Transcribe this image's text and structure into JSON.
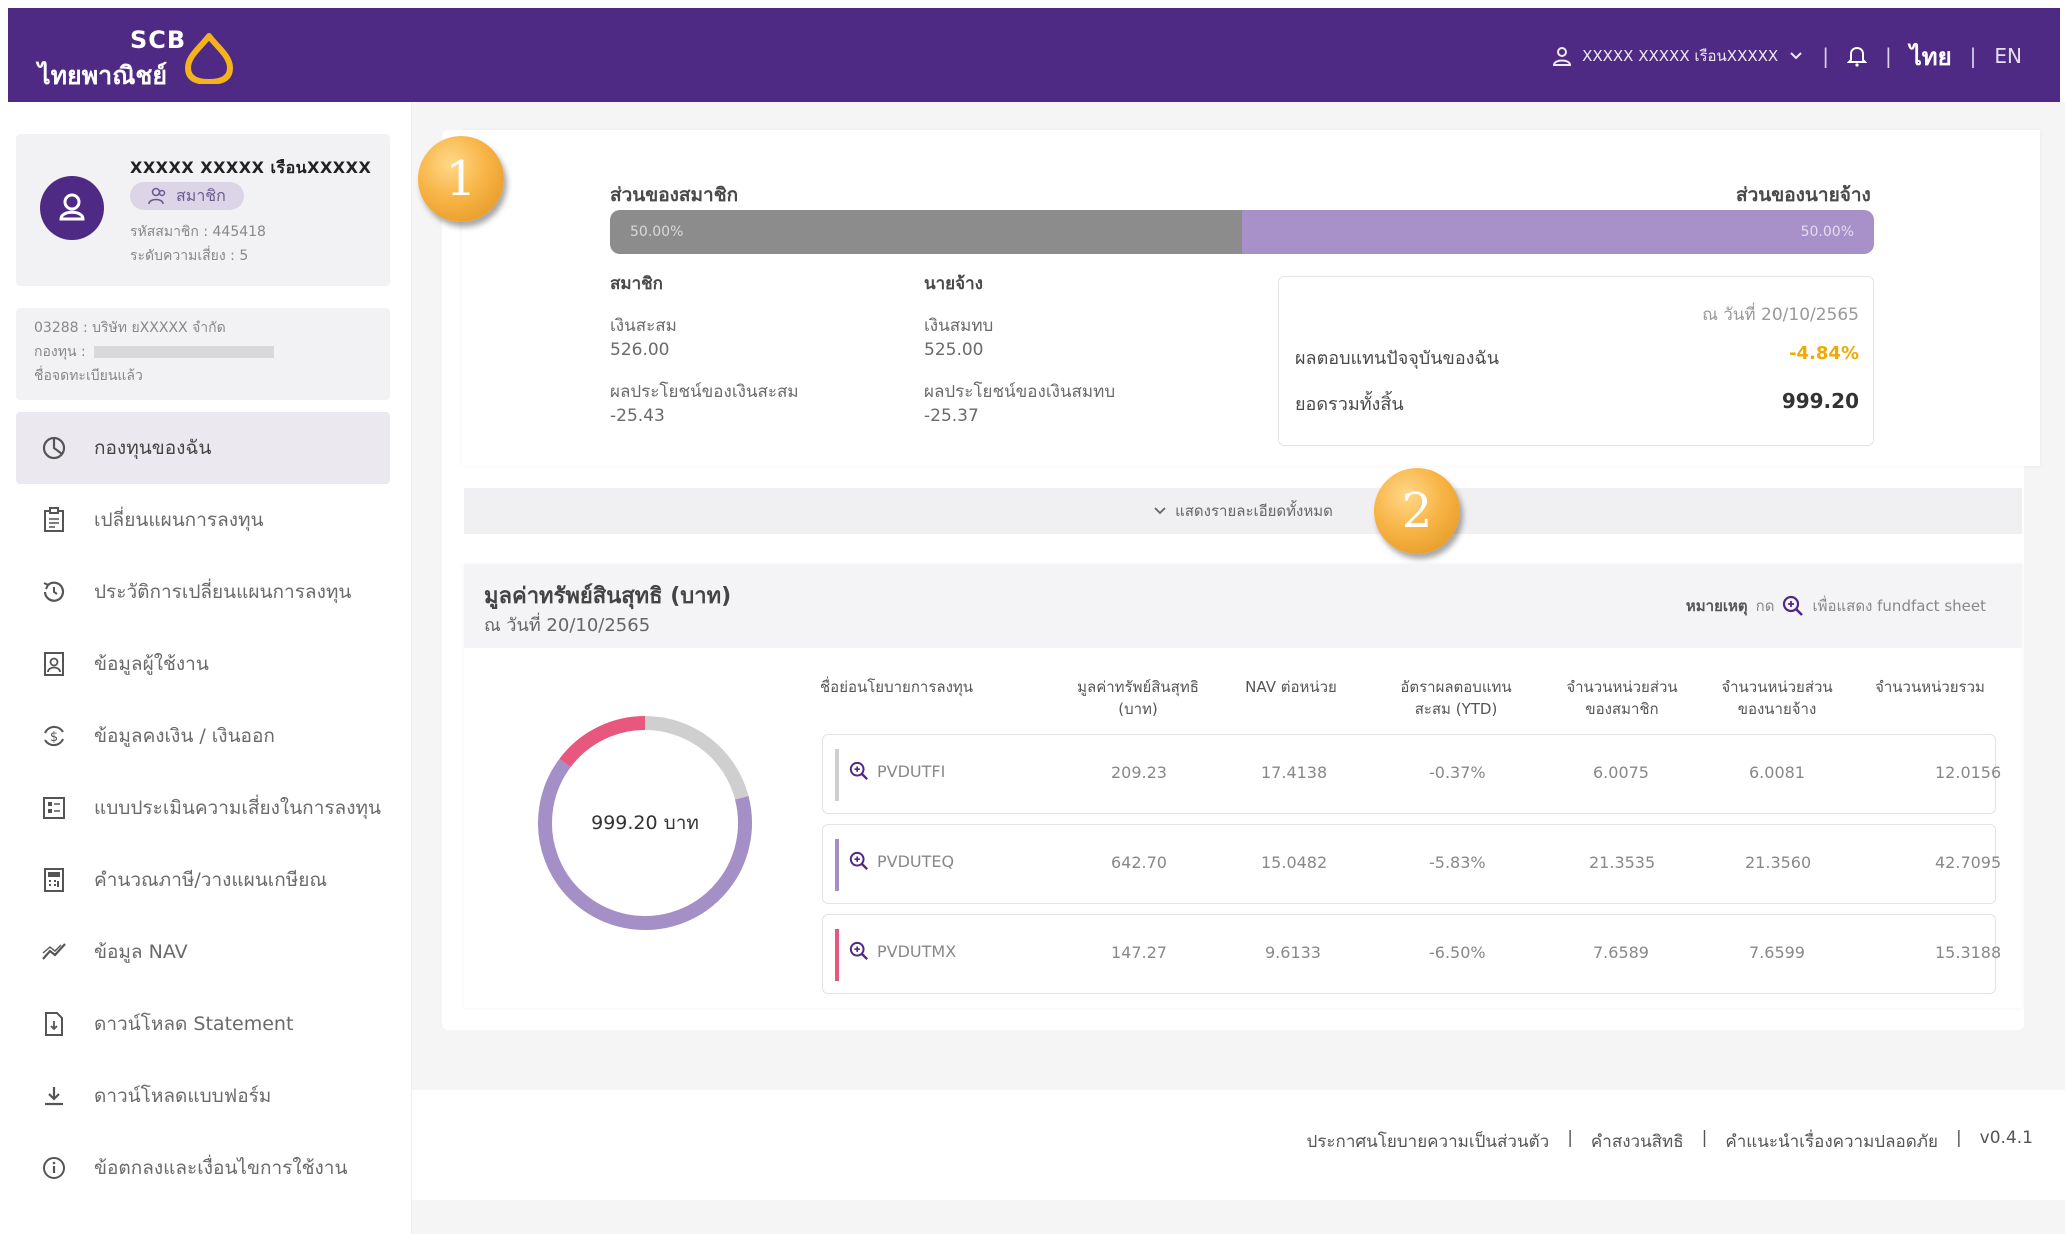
{
  "header": {
    "logo_text_top": "SCB",
    "logo_text_bottom": "ไทยพาณิชย์",
    "user_name": "XXXXX XXXXX เรือนXXXXX",
    "lang_th": "ไทย",
    "lang_en": "EN",
    "separator": "|"
  },
  "sidebar": {
    "profile": {
      "name": "XXXXX XXXXX เรือนXXXXX",
      "role": "สมาชิก",
      "member_id": "รหัสสมาชิก : 445418",
      "risk_level": "ระดับความเสี่ยง : 5"
    },
    "company": {
      "line1": "03288 : บริษัท ยXXXXX จำกัด",
      "line2": "กองทุน :",
      "line3": "ชื่อจดทะเบียนแล้ว"
    },
    "items": [
      {
        "label": "กองทุนของฉัน",
        "icon": "pie-chart-icon"
      },
      {
        "label": "เปลี่ยนแผนการลงทุน",
        "icon": "clipboard-icon"
      },
      {
        "label": "ประวัติการเปลี่ยนแผนการลงทุน",
        "icon": "history-icon"
      },
      {
        "label": "ข้อมูลผู้ใช้งาน",
        "icon": "user-card-icon"
      },
      {
        "label": "ข้อมูลคงเงิน / เงินออก",
        "icon": "money-cycle-icon"
      },
      {
        "label": "แบบประเมินความเสี่ยงในการลงทุน",
        "icon": "form-icon"
      },
      {
        "label": "คำนวณภาษี/วางแผนเกษียณ",
        "icon": "calculator-icon"
      },
      {
        "label": "ข้อมูล NAV",
        "icon": "chart-line-icon"
      },
      {
        "label": "ดาวน์โหลด Statement",
        "icon": "document-icon"
      },
      {
        "label": "ดาวน์โหลดแบบฟอร์ม",
        "icon": "download-icon"
      },
      {
        "label": "ข้อตกลงและเงื่อนไขการใช้งาน",
        "icon": "info-icon"
      }
    ]
  },
  "summary": {
    "member_share_label": "ส่วนของสมาชิก",
    "employer_share_label": "ส่วนของนายจ้าง",
    "member_pct": "50.00%",
    "employer_pct": "50.00%",
    "member_share_value": 50,
    "member": {
      "title": "สมาชิก",
      "contrib_label": "เงินสะสม",
      "contrib_value": "526.00",
      "benefit_label": "ผลประโยชน์ของเงินสะสม",
      "benefit_value": "-25.43"
    },
    "employer": {
      "title": "นายจ้าง",
      "contrib_label": "เงินสมทบ",
      "contrib_value": "525.00",
      "benefit_label": "ผลประโยชน์ของเงินสมทบ",
      "benefit_value": "-25.37"
    },
    "info": {
      "date": "ณ วันที่ 20/10/2565",
      "return_label": "ผลตอบแทนปัจจุบันของฉัน",
      "return_value": "-4.84%",
      "total_label": "ยอดรวมทั้งสิ้น",
      "total_value": "999.20"
    },
    "show_all": "แสดงรายละเอียดทั้งหมด",
    "callout_1": "1",
    "callout_2": "2"
  },
  "funds": {
    "title": "มูลค่าทรัพย์สินสุทธิ (บาท)",
    "date": "ณ วันที่ 20/10/2565",
    "note_prefix": "หมายเหตุ",
    "note_press": "กด",
    "note_suffix": "เพื่อแสดง fundfact sheet",
    "donut_total": "999.20 บาท",
    "headers": {
      "name": "ชื่อย่อนโยบายการลงทุน",
      "nav_value": "มูลค่าทรัพย์สินสุทธิ\n(บาท)",
      "nav_unit": "NAV ต่อหน่วย",
      "ytd": "อัตราผลตอบแทน\nสะสม (YTD)",
      "units_member": "จำนวนหน่วยส่วน\nของสมาชิก",
      "units_employer": "จำนวนหน่วยส่วน\nของนายจ้าง",
      "units_total": "จำนวนหน่วยรวม"
    },
    "rows": [
      {
        "name": "PVDUTFI",
        "value": "209.23",
        "nav": "17.4138",
        "ytd": "-0.37%",
        "um": "6.0075",
        "ue": "6.0081",
        "ut": "12.0156",
        "color": "#cfcfcf",
        "amount": 209.23
      },
      {
        "name": "PVDUTEQ",
        "value": "642.70",
        "nav": "15.0482",
        "ytd": "-5.83%",
        "um": "21.3535",
        "ue": "21.3560",
        "ut": "42.7095",
        "color": "#a48fc6",
        "amount": 642.7
      },
      {
        "name": "PVDUTMX",
        "value": "147.27",
        "nav": "9.6133",
        "ytd": "-6.50%",
        "um": "7.6589",
        "ue": "7.6599",
        "ut": "15.3188",
        "color": "#e8577e",
        "amount": 147.27
      }
    ]
  },
  "footer": {
    "privacy": "ประกาศนโยบายความเป็นส่วนตัว",
    "disclaimer": "คำสงวนสิทธิ",
    "security": "คำแนะนำเรื่องความปลอดภัย",
    "version": "v0.4.1",
    "sep": "|"
  }
}
